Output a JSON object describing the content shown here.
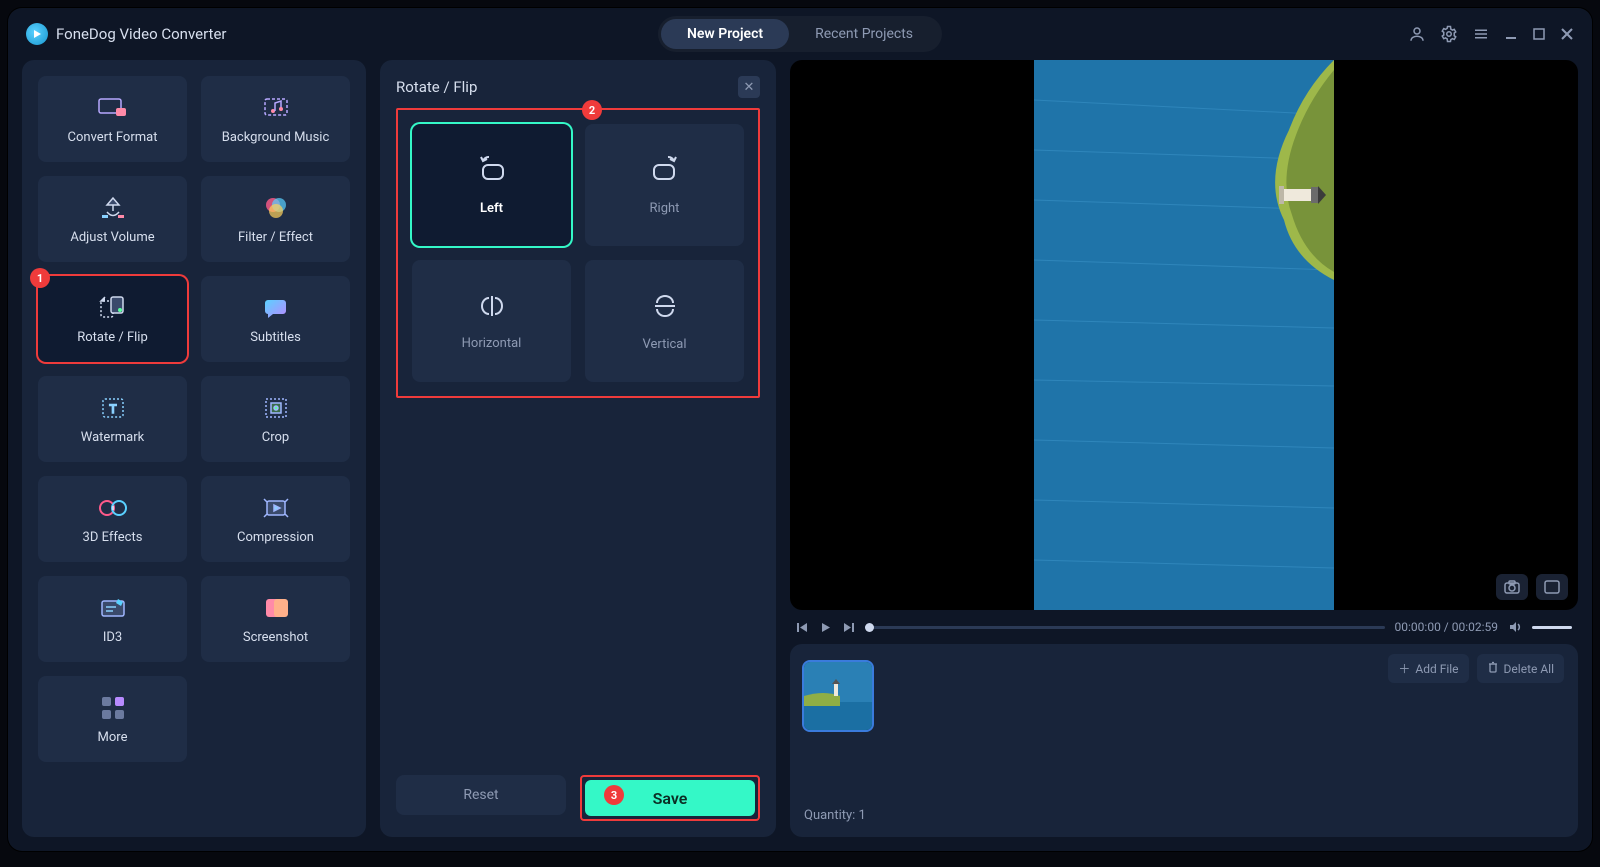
{
  "app": {
    "title": "FoneDog Video Converter"
  },
  "tabs": {
    "new": "New Project",
    "recent": "Recent Projects"
  },
  "tools": [
    {
      "id": "convert-format",
      "label": "Convert Format"
    },
    {
      "id": "background-music",
      "label": "Background Music"
    },
    {
      "id": "adjust-volume",
      "label": "Adjust Volume"
    },
    {
      "id": "filter-effect",
      "label": "Filter / Effect"
    },
    {
      "id": "rotate-flip",
      "label": "Rotate / Flip"
    },
    {
      "id": "subtitles",
      "label": "Subtitles"
    },
    {
      "id": "watermark",
      "label": "Watermark"
    },
    {
      "id": "crop",
      "label": "Crop"
    },
    {
      "id": "3d-effects",
      "label": "3D Effects"
    },
    {
      "id": "compression",
      "label": "Compression"
    },
    {
      "id": "id3",
      "label": "ID3"
    },
    {
      "id": "screenshot",
      "label": "Screenshot"
    },
    {
      "id": "more",
      "label": "More"
    }
  ],
  "panel": {
    "title": "Rotate / Flip",
    "options": {
      "left": "Left",
      "right": "Right",
      "horizontal": "Horizontal",
      "vertical": "Vertical"
    },
    "reset": "Reset",
    "save": "Save"
  },
  "player": {
    "time": "00:00:00 / 00:02:59"
  },
  "files": {
    "add": "Add File",
    "deleteAll": "Delete All",
    "quantity": "Quantity: 1"
  },
  "callouts": {
    "one": "1",
    "two": "2",
    "three": "3"
  }
}
